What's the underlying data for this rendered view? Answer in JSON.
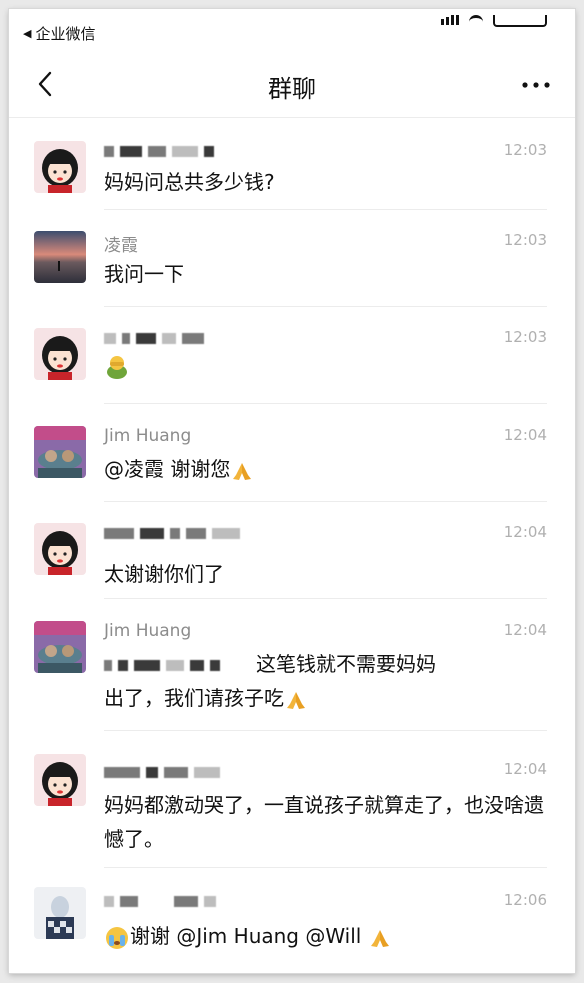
{
  "status": {
    "back_app": "企业微信"
  },
  "nav": {
    "title": "群聊"
  },
  "messages": [
    {
      "sender": "",
      "time": "12:03",
      "text": "妈妈问总共多少钱?"
    },
    {
      "sender": "凌霞",
      "time": "12:03",
      "text": "我问一下"
    },
    {
      "sender": "",
      "time": "12:03",
      "text": ""
    },
    {
      "sender": "Jim Huang",
      "time": "12:04",
      "text": "@凌霞 谢谢您"
    },
    {
      "sender": "",
      "time": "12:04",
      "text": "太谢谢你们了"
    },
    {
      "sender": "Jim Huang",
      "time": "12:04",
      "text_line1": "这笔钱就不需要妈妈",
      "text_line2": "出了，我们请孩子吃"
    },
    {
      "sender": "",
      "time": "12:04",
      "text": "妈妈都激动哭了，一直说孩子就算走了，也没啥遗憾了。"
    },
    {
      "sender": "",
      "time": "12:06",
      "text": "谢谢 @Jim Huang @Will"
    }
  ],
  "icons": {
    "back_app": "triangle-left-icon",
    "nav_back": "chevron-left-icon",
    "nav_more": "more-icon",
    "emoji_fist": "fist-emoji-icon",
    "emoji_pray": "pray-emoji-icon",
    "emoji_cry": "crying-emoji-icon"
  }
}
